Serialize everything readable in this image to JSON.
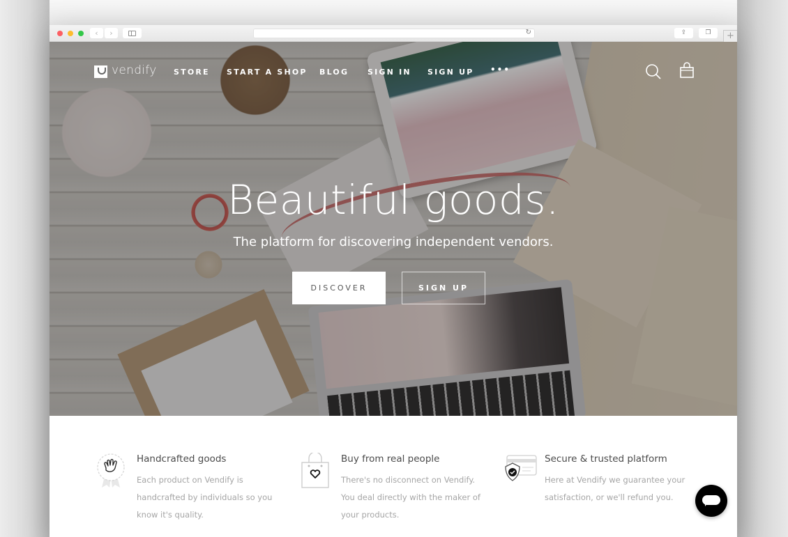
{
  "browser": {
    "back_glyph": "‹",
    "forward_glyph": "›",
    "reload_glyph": "↻",
    "share_glyph": "⇪",
    "tabs_glyph": "❐",
    "newtab_glyph": "+",
    "url": ""
  },
  "site": {
    "brand": "vendify",
    "nav": [
      {
        "label": "STORE"
      },
      {
        "label": "START A SHOP"
      },
      {
        "label": "BLOG"
      },
      {
        "label": "SIGN IN"
      },
      {
        "label": "SIGN UP"
      },
      {
        "label": "•••"
      }
    ],
    "icons": {
      "search": "search-icon",
      "cart": "shopping-bag-icon"
    }
  },
  "hero": {
    "title": "Beautiful goods.",
    "subtitle": "The platform for discovering independent vendors.",
    "primary_cta": "DISCOVER",
    "secondary_cta": "SIGN UP"
  },
  "features": [
    {
      "icon": "handcrafted-badge-icon",
      "title": "Handcrafted goods",
      "description": "Each product on Vendify is handcrafted by individuals so you know it's quality."
    },
    {
      "icon": "shopping-bag-heart-icon",
      "title": "Buy from real people",
      "description": "There's no disconnect on Vendify. You deal directly with the maker of your products."
    },
    {
      "icon": "secure-card-shield-icon",
      "title": "Secure & trusted platform",
      "description": "Here at Vendify we guarantee your satisfaction, or we'll refund you."
    }
  ],
  "chat": {
    "icon": "chat-bubble-icon"
  },
  "colors": {
    "traffic_red": "#fc5f63",
    "traffic_yellow": "#fdbc2e",
    "traffic_green": "#33c748",
    "text_dark": "#4a4a4a",
    "text_muted": "#a5a5a5",
    "chat_bg": "#000000"
  }
}
